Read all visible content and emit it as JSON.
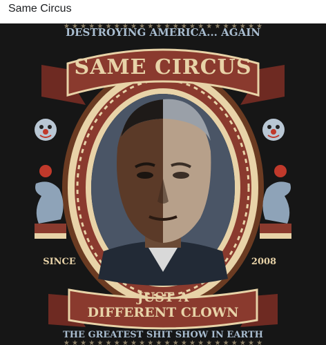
{
  "post": {
    "caption": "Same Circus"
  },
  "poster": {
    "top_text": "DESTROYING AMERICA... AGAIN",
    "title": "SAME CIRCUS",
    "left_label": "SINCE",
    "right_label": "2008",
    "banner_line1": "JUST A",
    "banner_line2": "DIFFERENT CLOWN",
    "bottom_text": "THE GREATEST SHIT SHOW IN EARTH",
    "colors": {
      "background": "#141414",
      "cream": "#e8d3a8",
      "ribbon_red": "#8a3a2e",
      "frame_brown": "#6b3b22",
      "slate_blue": "#8ea3b8",
      "text_blue": "#a9bdd0"
    },
    "icons": [
      "clown-face-icon",
      "seal-with-ball-icon",
      "star-row-icon"
    ]
  }
}
